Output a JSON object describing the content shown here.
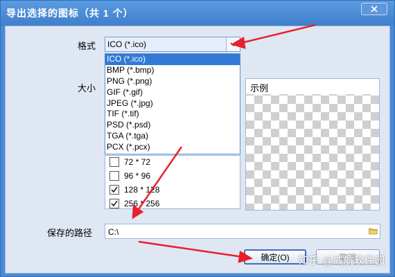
{
  "window": {
    "title": "导出选择的图标（共 1 个）"
  },
  "format": {
    "label": "格式",
    "selected": "ICO (*.ico)",
    "options": [
      "ICO (*.ico)",
      "BMP (*.bmp)",
      "PNG (*.png)",
      "GIF (*.gif)",
      "JPEG (*.jpg)",
      "TIF (*.tif)",
      "PSD (*.psd)",
      "TGA (*.tga)",
      "PCX (*.pcx)"
    ]
  },
  "size": {
    "label": "大小",
    "items": [
      {
        "label": "72 * 72",
        "checked": false
      },
      {
        "label": "96 * 96",
        "checked": false
      },
      {
        "label": "128 * 128",
        "checked": true
      },
      {
        "label": "256 * 256",
        "checked": true
      }
    ]
  },
  "preview": {
    "label": "示例"
  },
  "path": {
    "label": "保存的路径",
    "value": "C:\\"
  },
  "buttons": {
    "ok": "确定(O)",
    "cancel": "取消"
  },
  "watermark": "知乎 @威航软件园",
  "colors": {
    "title_bar": "#4a8bd6",
    "selection": "#3179d5",
    "arrow": "#e8202a"
  }
}
